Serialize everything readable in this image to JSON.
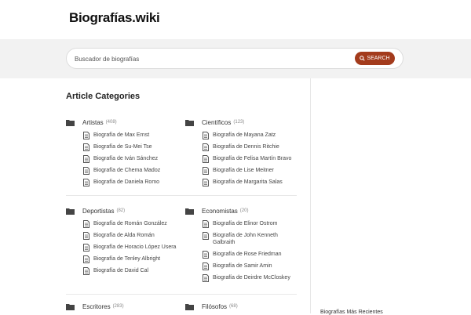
{
  "site": {
    "logo": "Biografías.wiki"
  },
  "search": {
    "placeholder": "Buscador de biografías",
    "button_label": "SEARCH"
  },
  "section_title": "Article Categories",
  "categories": [
    {
      "name": "Artistas",
      "count": "(408)",
      "items": [
        "Biografía de Max Ernst",
        "Biografía de Su-Mei Tse",
        "Biografía de Iván Sánchez",
        "Biografía de Chema Madoz",
        "Biografía de Daniela Romo"
      ]
    },
    {
      "name": "Científicos",
      "count": "(123)",
      "items": [
        "Biografía de Mayana Zatz",
        "Biografía de Dennis Ritchie",
        "Biografía de Felisa Martín Bravo",
        "Biografía de Lise Meitner",
        "Biografía de Margarita Salas"
      ]
    },
    {
      "name": "Deportistas",
      "count": "(82)",
      "items": [
        "Biografía de Román González",
        "Biografía de Alda Román",
        "Biografía de Horacio López Usera",
        "Biografía de Tenley Albright",
        "Biografía de David Cal"
      ]
    },
    {
      "name": "Economistas",
      "count": "(20)",
      "items": [
        "Biografía de Elinor Ostrom",
        "Biografía de John Kenneth Galbraith",
        "Biografía de Rose Friedman",
        "Biografía de Samir Amin",
        "Biografía de Deirdre McCloskey"
      ]
    },
    {
      "name": "Escritores",
      "count": "(283)",
      "items": []
    },
    {
      "name": "Filósofos",
      "count": "(68)",
      "items": []
    }
  ],
  "sidebar": {
    "recent_title": "Biografías Más Recientes"
  },
  "colors": {
    "accent": "#a33b1c",
    "band": "#f2f2f2"
  }
}
